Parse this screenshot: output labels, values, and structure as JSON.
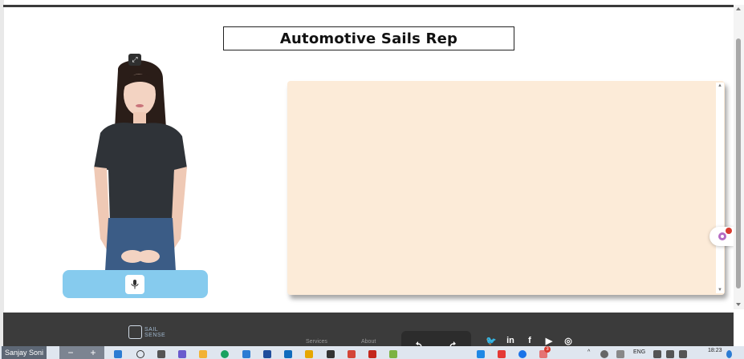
{
  "page": {
    "title": "Automotive Sails Rep"
  },
  "avatar": {
    "expand_icon": "expand-icon",
    "description_icon": "avatar-icon"
  },
  "mic": {
    "icon": "microphone-icon"
  },
  "chat": {
    "background_color": "#fcebd8"
  },
  "footer": {
    "logo_line1": "SAIL",
    "logo_line2": "SENSE",
    "links": [
      "Services",
      "About"
    ],
    "social_icons": [
      "twitter-icon",
      "linkedin-icon",
      "facebook-icon",
      "youtube-icon",
      "instagram-icon"
    ]
  },
  "overlay": {
    "rotate_left_icon": "rotate-left-icon",
    "rotate_right_icon": "rotate-right-icon"
  },
  "taskbar": {
    "user": "Sanjay Soni",
    "zoom_out": "−",
    "zoom_in": "+",
    "language": "ENG",
    "time": "18:23",
    "notification_count": "3"
  },
  "colors": {
    "accent_mic_bar": "#86cbee",
    "footer_bg": "#3b3b3b",
    "badge": "#d83a2f"
  }
}
